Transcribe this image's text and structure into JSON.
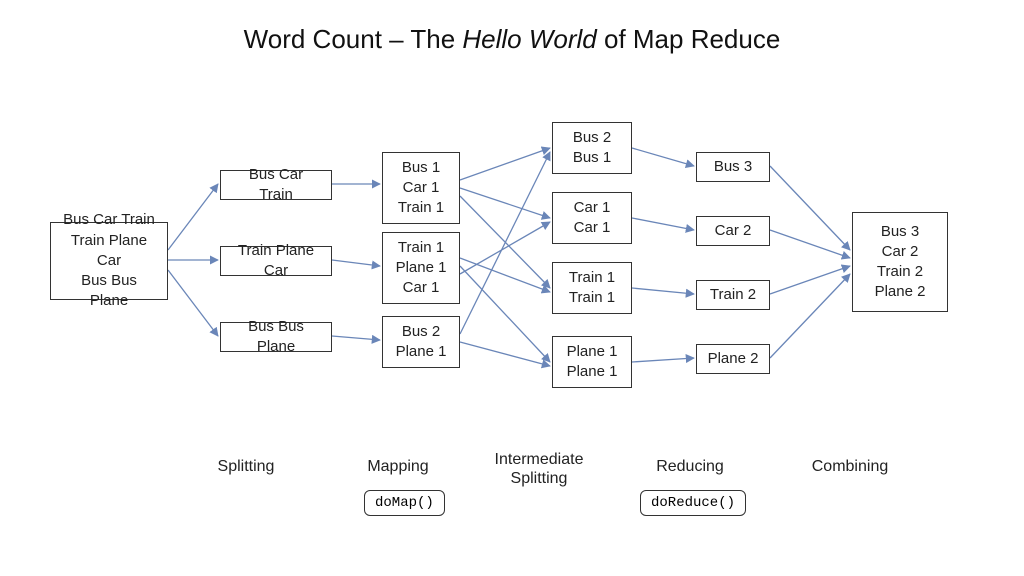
{
  "title_prefix": "Word Count – The ",
  "title_italic": "Hello World",
  "title_suffix": " of Map Reduce",
  "input": "Bus Car Train\nTrain Plane Car\nBus Bus Plane",
  "splits": [
    "Bus Car Train",
    "Train Plane Car",
    "Bus Bus Plane"
  ],
  "maps": [
    "Bus 1\nCar 1\nTrain 1",
    "Train 1\nPlane 1\nCar 1",
    "Bus 2\nPlane 1"
  ],
  "shuffles": [
    "Bus 2\nBus 1",
    "Car 1\nCar 1",
    "Train 1\nTrain 1",
    "Plane 1\nPlane 1"
  ],
  "reduces": [
    "Bus 3",
    "Car 2",
    "Train 2",
    "Plane 2"
  ],
  "output": "Bus 3\nCar 2\nTrain 2\nPlane 2",
  "stages": {
    "splitting": "Splitting",
    "mapping": "Mapping",
    "intermediate": "Intermediate\nSplitting",
    "reducing": "Reducing",
    "combining": "Combining"
  },
  "fn_map": "doMap()",
  "fn_reduce": "doReduce()"
}
